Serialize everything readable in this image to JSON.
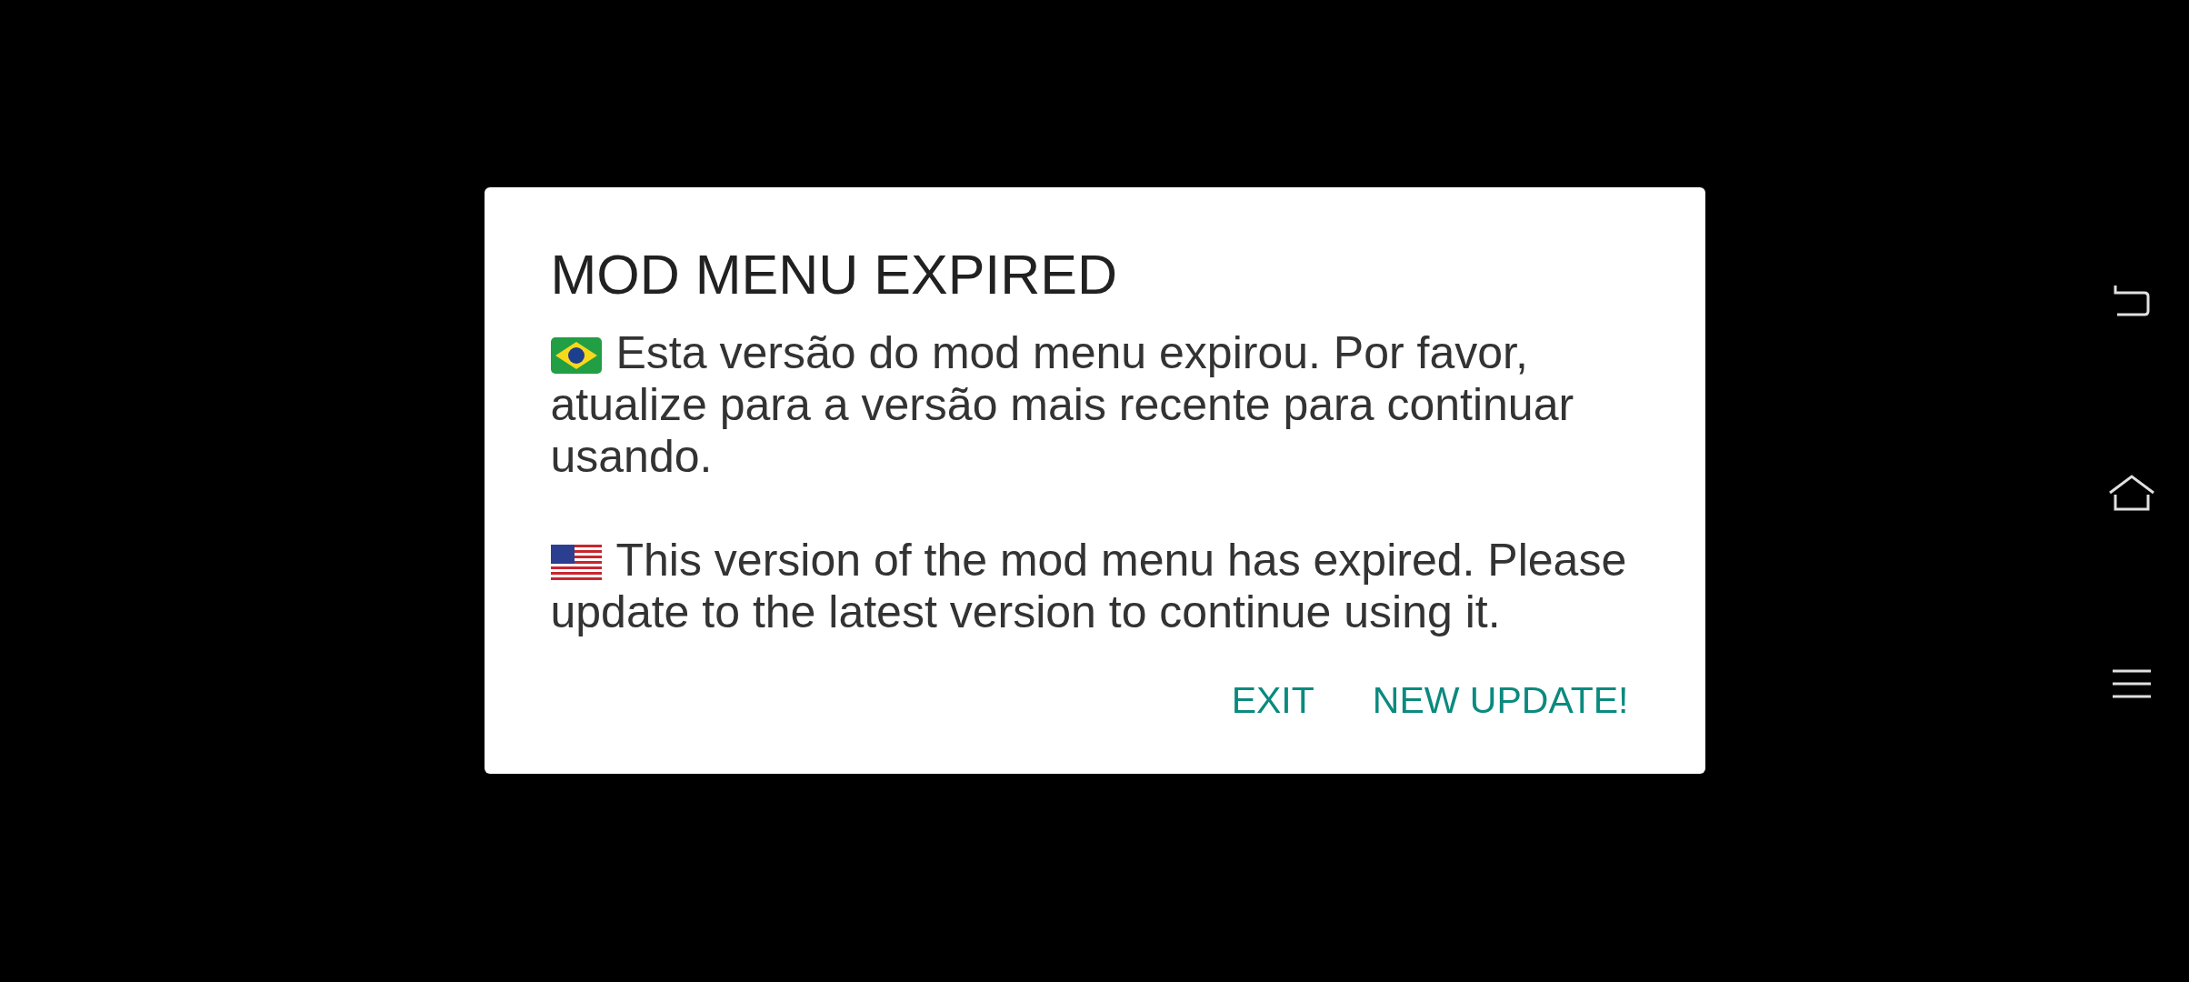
{
  "dialog": {
    "title": "MOD MENU EXPIRED",
    "messages": [
      {
        "kind": "brazil",
        "text": "Esta versão do mod menu expirou. Por favor, atualize para a versão mais recente para continuar usando."
      },
      {
        "kind": "usa",
        "text": "This version of the mod menu has expired. Please update to the latest version to continue using it."
      }
    ],
    "buttons": [
      "EXIT",
      "NEW UPDATE!"
    ]
  }
}
